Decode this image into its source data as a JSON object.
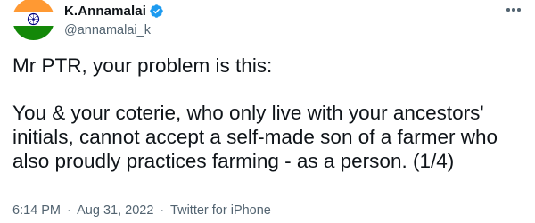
{
  "author": {
    "display_name": "K.Annamalai",
    "handle": "@annamalai_k",
    "verified": true,
    "avatar_icon": "india-flag-avatar",
    "verified_icon": "verified-badge-icon"
  },
  "tweet": {
    "paragraphs": [
      "Mr PTR, your problem is this:",
      "You & your coterie, who only live with your ancestors' initials, cannot accept a self-made son of a farmer who also proudly practices farming - as a person. (1/4)"
    ]
  },
  "meta": {
    "time": "6:14 PM",
    "separator": "·",
    "date": "Aug 31, 2022",
    "source": "Twitter for iPhone"
  },
  "colors": {
    "text": "#0f1419",
    "secondary": "#536471",
    "verified": "#1d9bf0",
    "saffron": "#ff9933",
    "green": "#138808",
    "chakra": "#000080"
  }
}
